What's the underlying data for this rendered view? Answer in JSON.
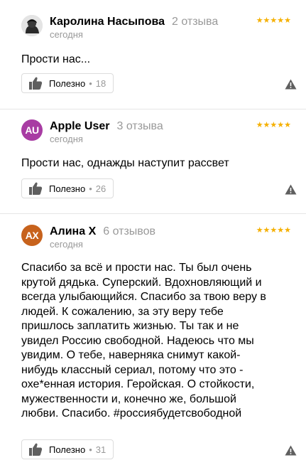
{
  "reviews": [
    {
      "author": "Каролина Насыпова",
      "review_count": "2 отзыва",
      "date": "сегодня",
      "rating_stars": "★★★★★",
      "text": "Прости нас...",
      "helpful_label": "Полезно",
      "helpful_count": "18",
      "avatar": {
        "type": "photo",
        "initials": ""
      }
    },
    {
      "author": "Apple User",
      "review_count": "3 отзыва",
      "date": "сегодня",
      "rating_stars": "★★★★★",
      "text": "Прости нас, однажды наступит рассвет",
      "helpful_label": "Полезно",
      "helpful_count": "26",
      "avatar": {
        "type": "initials",
        "initials": "AU",
        "color": "#a83ca3"
      }
    },
    {
      "author": "Алина X",
      "review_count": "6 отзывов",
      "date": "сегодня",
      "rating_stars": "★★★★★",
      "text": "Спасибо за всё и прости нас. Ты был очень крутой дядька. Суперский. Вдохновляющий и всегда улыбающийся. Спасибо за твою веру в людей. К сожалению, за эту веру тебе пришлось заплатить жизнью. Ты так и не увидел Россию свободной. Надеюсь что мы увидим. О тебе, наверняка снимут какой-нибудь классный сериал, потому что это - охе*енная история. Геройская. О стойкости, мужественности и, конечно же, большой любви. Спасибо. #россиябудетсвободной",
      "helpful_label": "Полезно",
      "helpful_count": "31",
      "avatar": {
        "type": "initials",
        "initials": "AX",
        "color": "#c7621c"
      }
    }
  ],
  "icons": {
    "helpful": "thumbs-up-icon",
    "report": "warning-icon",
    "rating": "star-icon"
  },
  "colors": {
    "star": "#f5b000",
    "muted_text": "#999999",
    "icon_gray": "#5f5f5f"
  }
}
